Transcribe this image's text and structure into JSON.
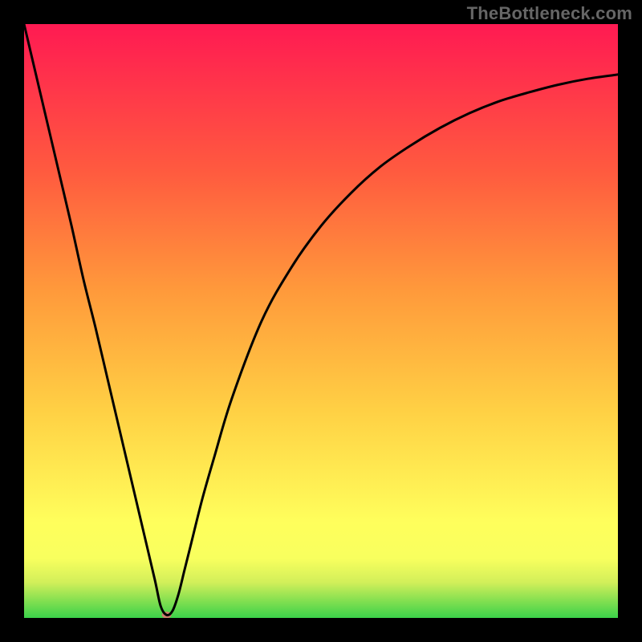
{
  "watermark": "TheBottleneck.com",
  "chart_data": {
    "type": "line",
    "title": "",
    "xlabel": "",
    "ylabel": "",
    "xlim": [
      0,
      100
    ],
    "ylim": [
      0,
      100
    ],
    "background": {
      "gradient_stops": [
        {
          "pos": 0.0,
          "color": "#3bd24a"
        },
        {
          "pos": 0.03,
          "color": "#86e051"
        },
        {
          "pos": 0.06,
          "color": "#d2ef5a"
        },
        {
          "pos": 0.1,
          "color": "#f8ff5e"
        },
        {
          "pos": 0.16,
          "color": "#ffff5c"
        },
        {
          "pos": 0.35,
          "color": "#ffd044"
        },
        {
          "pos": 0.55,
          "color": "#ff9a3b"
        },
        {
          "pos": 0.75,
          "color": "#ff5b3f"
        },
        {
          "pos": 1.0,
          "color": "#ff1a52"
        }
      ]
    },
    "series": [
      {
        "name": "bottleneck-curve",
        "color": "#000000",
        "x": [
          0,
          2,
          4,
          6,
          8,
          10,
          12,
          14,
          16,
          18,
          20,
          22,
          23,
          24,
          25,
          26,
          27,
          28,
          30,
          32,
          35,
          40,
          45,
          50,
          55,
          60,
          65,
          70,
          75,
          80,
          85,
          90,
          95,
          100
        ],
        "y": [
          100,
          91.5,
          83,
          74.5,
          66,
          57,
          49,
          40.5,
          32,
          23.5,
          15,
          6.5,
          2,
          0.5,
          1.2,
          4,
          8,
          12,
          20,
          27,
          37,
          50,
          59,
          66,
          71.5,
          76,
          79.5,
          82.5,
          85,
          87,
          88.5,
          89.8,
          90.8,
          91.5
        ]
      }
    ],
    "marker": {
      "name": "min-point",
      "x": 24,
      "y": 0.5,
      "rx": 6,
      "ry": 4,
      "color": "#cf7f6e"
    }
  }
}
